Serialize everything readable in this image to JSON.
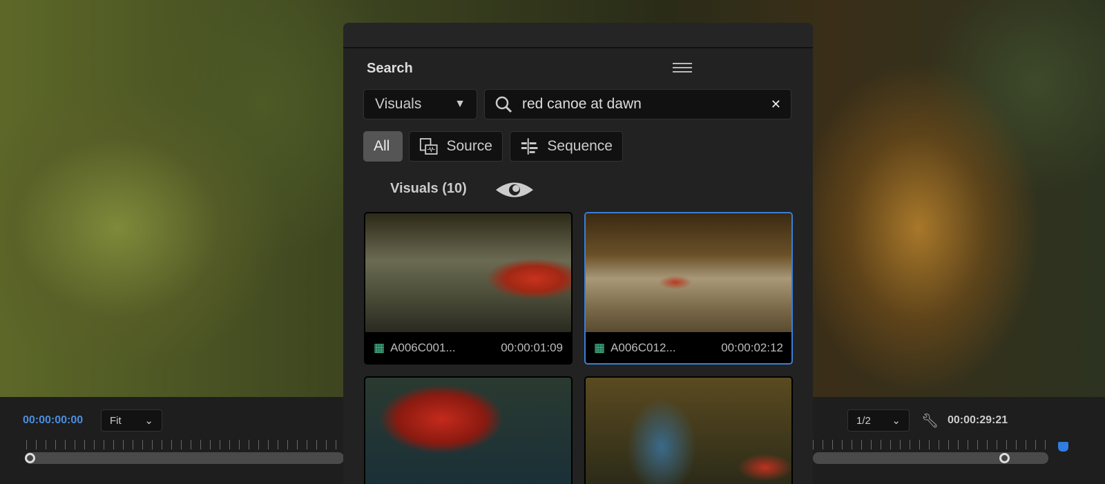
{
  "player": {
    "current_time": "00:00:00:00",
    "zoom": "Fit",
    "resolution": "1/2",
    "duration": "00:00:29:21",
    "playhead_fraction": 0.79
  },
  "panel": {
    "title": "Search",
    "scope": "Visuals",
    "query": "red canoe at dawn",
    "filters": [
      {
        "label": "All",
        "active": true
      },
      {
        "label": "Source",
        "active": false
      },
      {
        "label": "Sequence",
        "active": false
      }
    ],
    "results_heading": "Visuals (10)",
    "results": [
      {
        "name": "A006C001...",
        "duration": "00:00:01:09",
        "selected": false
      },
      {
        "name": "A006C012...",
        "duration": "00:00:02:12",
        "selected": true
      },
      {
        "name": "",
        "duration": "",
        "selected": false
      },
      {
        "name": "",
        "duration": "",
        "selected": false
      }
    ]
  },
  "colors": {
    "accent": "#3b7fd6",
    "timecode": "#4a8fe0"
  }
}
